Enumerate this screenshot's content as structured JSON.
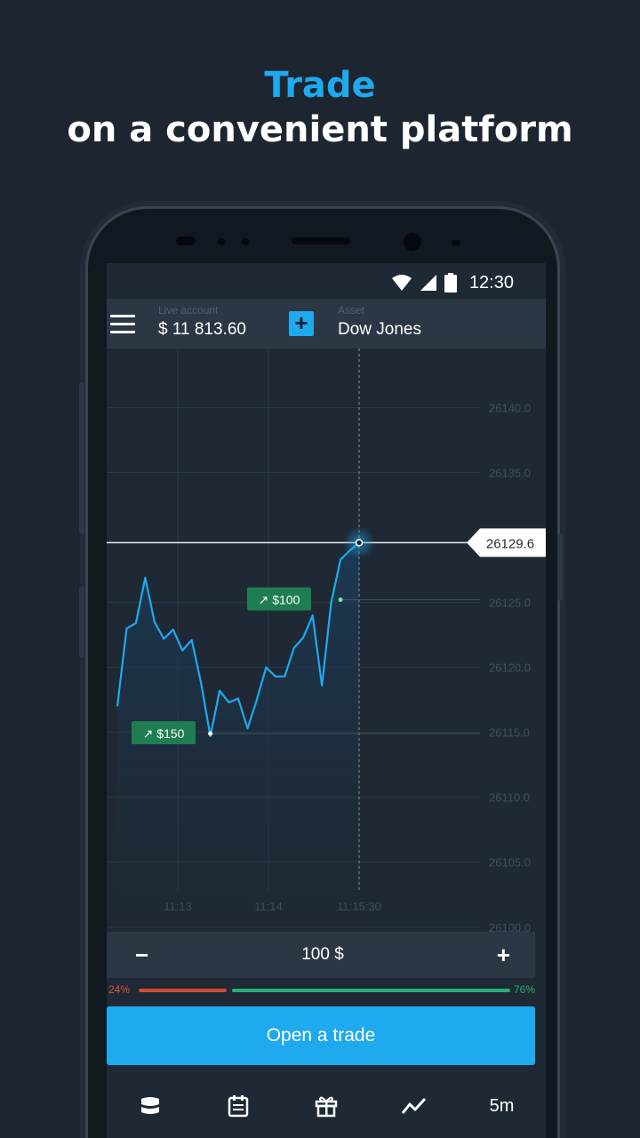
{
  "headline": {
    "line1": "Trade",
    "line2": "on a convenient platform"
  },
  "status_bar": {
    "time": "12:30",
    "icons": [
      "wifi-icon",
      "signal-icon",
      "battery-icon"
    ]
  },
  "top_bar": {
    "account_label": "Live account",
    "account_value": "$ 11 813.60",
    "asset_label": "Asset",
    "asset_value": "Dow Jones",
    "plus_label": "+"
  },
  "chart_data": {
    "type": "line",
    "ylim": [
      26098,
      26144
    ],
    "y_ticks": [
      "26140.0",
      "26135.0",
      "26125.0",
      "26120.0",
      "26115.0",
      "26110.0",
      "26105.0",
      "26100.0"
    ],
    "y_tick_values": [
      26140,
      26135,
      26125,
      26120,
      26115,
      26110,
      26105,
      26100
    ],
    "x_ticks": [
      "11:13",
      "11:14",
      "11:15:30"
    ],
    "current_price_label": "26129.6",
    "current_price": 26129.6,
    "series": [
      {
        "values": [
          26117,
          26123,
          26123.4,
          26126.9,
          26123.5,
          26122.2,
          26122.9,
          26121.3,
          26122.1,
          26118.8,
          26114.7,
          26118.2,
          26117.3,
          26117.6,
          26115.3,
          26117.5,
          26120,
          26119.3,
          26119.3,
          26121.5,
          26122.3,
          26124,
          26118.6,
          26125,
          26128.3,
          26129,
          26129.6
        ]
      }
    ],
    "markers": [
      {
        "label": "↗ $150",
        "price": 26114.9
      },
      {
        "label": "↗ $100",
        "price": 26125.2
      }
    ]
  },
  "amount": {
    "minus": "−",
    "value": "100 $",
    "plus": "+"
  },
  "sentiment": {
    "left_label": "24%",
    "right_label": "76%",
    "down_fraction": 0.24,
    "up_fraction": 0.76
  },
  "open_trade_label": "Open a trade",
  "bottom_nav": {
    "timeframe": "5m",
    "items": [
      "layers-icon",
      "calendar-icon",
      "gift-icon",
      "chart-icon"
    ]
  },
  "colors": {
    "accent": "#1fa9ef",
    "up": "#27ae76",
    "down": "#d24b36",
    "background": "#1c2530"
  }
}
